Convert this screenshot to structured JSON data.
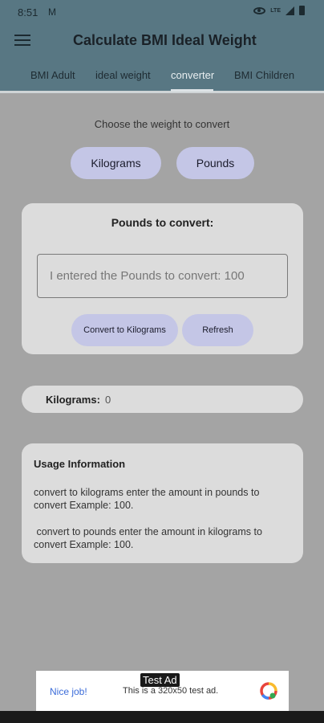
{
  "status_bar": {
    "time": "8:51",
    "mail_glyph": "M",
    "network": "LTE"
  },
  "app_bar": {
    "title": "Calculate BMI Ideal Weight",
    "tabs": [
      {
        "label": "BMI Adult"
      },
      {
        "label": "ideal weight"
      },
      {
        "label": "converter"
      },
      {
        "label": "BMI Children"
      }
    ],
    "active_tab": "converter"
  },
  "converter": {
    "choose_label": "Choose the weight to convert",
    "kilograms_button": "Kilograms",
    "pounds_button": "Pounds",
    "input_card_title": "Pounds to convert:",
    "input_placeholder": "I entered the Pounds to convert: 100",
    "convert_button": "Convert to Kilograms",
    "refresh_button": "Refresh"
  },
  "result": {
    "label": "Kilograms:",
    "value": "0"
  },
  "usage": {
    "title": "Usage Information",
    "paragraph_1": "convert to kilograms enter the amount in pounds to convert Example: 100.",
    "paragraph_2": " convert to pounds enter the amount in kilograms to convert Example: 100."
  },
  "ad": {
    "tag": "Test Ad",
    "nice_job": "Nice job!",
    "text": "This is a 320x50 test ad."
  },
  "colors": {
    "app_bar": "#587783",
    "background": "#a4a4a4",
    "card": "#dcdcdc",
    "pill": "#c4c6e6"
  }
}
